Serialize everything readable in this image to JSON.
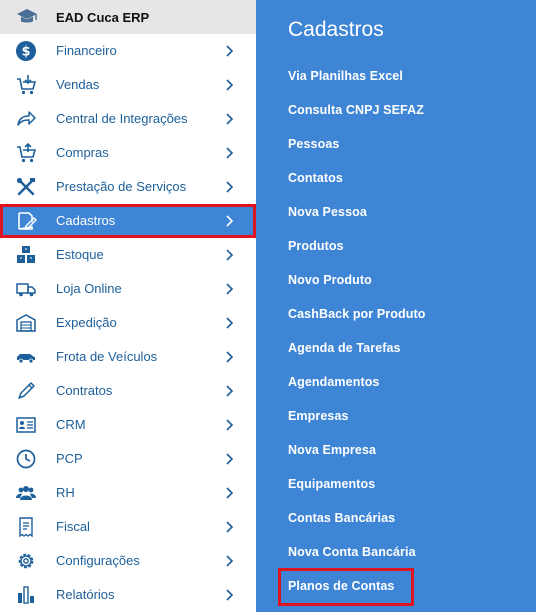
{
  "brand": {
    "label": "EAD Cuca ERP",
    "icon": "graduation-cap-icon"
  },
  "colors": {
    "accent": "#3f85d6",
    "icon": "#1d5f9a",
    "highlight": "#e0141e",
    "brand_bg": "#e6e6e6"
  },
  "menu": {
    "items": [
      {
        "label": "Financeiro",
        "icon": "dollar-circle-icon"
      },
      {
        "label": "Vendas",
        "icon": "cart-download-icon"
      },
      {
        "label": "Central de Integrações",
        "icon": "share-arrow-icon"
      },
      {
        "label": "Compras",
        "icon": "cart-upload-icon"
      },
      {
        "label": "Prestação de Serviços",
        "icon": "tools-icon"
      },
      {
        "label": "Cadastros",
        "icon": "edit-document-icon",
        "active": true
      },
      {
        "label": "Estoque",
        "icon": "boxes-icon"
      },
      {
        "label": "Loja Online",
        "icon": "delivery-truck-icon"
      },
      {
        "label": "Expedição",
        "icon": "warehouse-icon"
      },
      {
        "label": "Frota de Veículos",
        "icon": "car-icon"
      },
      {
        "label": "Contratos",
        "icon": "pen-icon"
      },
      {
        "label": "CRM",
        "icon": "id-card-icon"
      },
      {
        "label": "PCP",
        "icon": "clock-icon"
      },
      {
        "label": "RH",
        "icon": "people-icon"
      },
      {
        "label": "Fiscal",
        "icon": "receipt-icon"
      },
      {
        "label": "Configurações",
        "icon": "gear-icon"
      },
      {
        "label": "Relatórios",
        "icon": "bar-chart-icon"
      }
    ]
  },
  "submenu": {
    "title": "Cadastros",
    "items": [
      "Via Planilhas Excel",
      "Consulta CNPJ SEFAZ",
      "Pessoas",
      "Contatos",
      "Nova Pessoa",
      "Produtos",
      "Novo Produto",
      "CashBack por Produto",
      "Agenda de Tarefas",
      "Agendamentos",
      "Empresas",
      "Nova Empresa",
      "Equipamentos",
      "Contas Bancárias",
      "Nova Conta Bancária",
      "Planos de Contas"
    ]
  }
}
